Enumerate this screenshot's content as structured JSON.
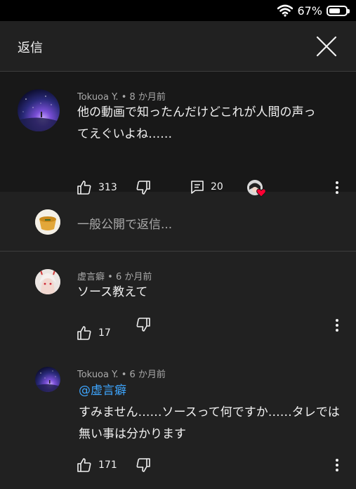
{
  "status": {
    "battery": "67%",
    "battery_level": 0.67
  },
  "header": {
    "title": "返信"
  },
  "parent_comment": {
    "author": "Tokuoa Y.",
    "time": "8 か月前",
    "line1": "他の動画で知ったんだけどこれが人間の声っ",
    "line2": "てえぐいよね……",
    "likes": "313",
    "replies": "20"
  },
  "reply_input": {
    "placeholder": "一般公開で返信..."
  },
  "replies": [
    {
      "author": "虚言癖",
      "time": "6 か月前",
      "text": "ソース教えて",
      "likes": "17"
    },
    {
      "author": "Tokuoa Y.",
      "time": "6 か月前",
      "mention": "@虚言癖",
      "line1": "すみません……ソースって何ですか……タレでは",
      "line2": "無い事は分かります",
      "likes": "171"
    }
  ],
  "colors": {
    "panel": "#212121",
    "parent_bg": "#181818",
    "link": "#3ea6ff",
    "heart": "#ff0033"
  },
  "icons": [
    "wifi-icon",
    "battery-icon",
    "close-icon",
    "thumb-up-icon",
    "thumb-down-icon",
    "reply-icon",
    "creator-heart-icon",
    "more-icon"
  ]
}
